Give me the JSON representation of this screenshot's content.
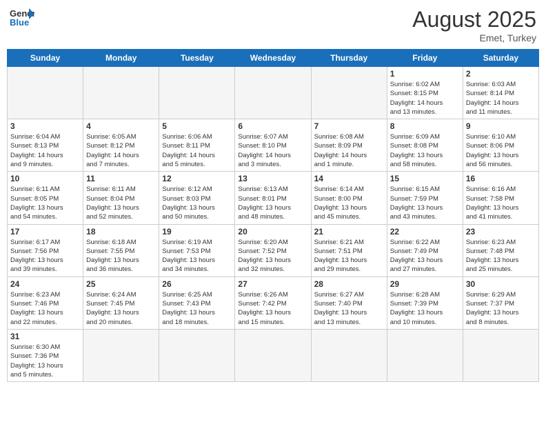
{
  "header": {
    "logo_text_general": "General",
    "logo_text_blue": "Blue",
    "month_year": "August 2025",
    "location": "Emet, Turkey"
  },
  "days_of_week": [
    "Sunday",
    "Monday",
    "Tuesday",
    "Wednesday",
    "Thursday",
    "Friday",
    "Saturday"
  ],
  "weeks": [
    [
      {
        "day": "",
        "info": ""
      },
      {
        "day": "",
        "info": ""
      },
      {
        "day": "",
        "info": ""
      },
      {
        "day": "",
        "info": ""
      },
      {
        "day": "",
        "info": ""
      },
      {
        "day": "1",
        "info": "Sunrise: 6:02 AM\nSunset: 8:15 PM\nDaylight: 14 hours\nand 13 minutes."
      },
      {
        "day": "2",
        "info": "Sunrise: 6:03 AM\nSunset: 8:14 PM\nDaylight: 14 hours\nand 11 minutes."
      }
    ],
    [
      {
        "day": "3",
        "info": "Sunrise: 6:04 AM\nSunset: 8:13 PM\nDaylight: 14 hours\nand 9 minutes."
      },
      {
        "day": "4",
        "info": "Sunrise: 6:05 AM\nSunset: 8:12 PM\nDaylight: 14 hours\nand 7 minutes."
      },
      {
        "day": "5",
        "info": "Sunrise: 6:06 AM\nSunset: 8:11 PM\nDaylight: 14 hours\nand 5 minutes."
      },
      {
        "day": "6",
        "info": "Sunrise: 6:07 AM\nSunset: 8:10 PM\nDaylight: 14 hours\nand 3 minutes."
      },
      {
        "day": "7",
        "info": "Sunrise: 6:08 AM\nSunset: 8:09 PM\nDaylight: 14 hours\nand 1 minute."
      },
      {
        "day": "8",
        "info": "Sunrise: 6:09 AM\nSunset: 8:08 PM\nDaylight: 13 hours\nand 58 minutes."
      },
      {
        "day": "9",
        "info": "Sunrise: 6:10 AM\nSunset: 8:06 PM\nDaylight: 13 hours\nand 56 minutes."
      }
    ],
    [
      {
        "day": "10",
        "info": "Sunrise: 6:11 AM\nSunset: 8:05 PM\nDaylight: 13 hours\nand 54 minutes."
      },
      {
        "day": "11",
        "info": "Sunrise: 6:11 AM\nSunset: 8:04 PM\nDaylight: 13 hours\nand 52 minutes."
      },
      {
        "day": "12",
        "info": "Sunrise: 6:12 AM\nSunset: 8:03 PM\nDaylight: 13 hours\nand 50 minutes."
      },
      {
        "day": "13",
        "info": "Sunrise: 6:13 AM\nSunset: 8:01 PM\nDaylight: 13 hours\nand 48 minutes."
      },
      {
        "day": "14",
        "info": "Sunrise: 6:14 AM\nSunset: 8:00 PM\nDaylight: 13 hours\nand 45 minutes."
      },
      {
        "day": "15",
        "info": "Sunrise: 6:15 AM\nSunset: 7:59 PM\nDaylight: 13 hours\nand 43 minutes."
      },
      {
        "day": "16",
        "info": "Sunrise: 6:16 AM\nSunset: 7:58 PM\nDaylight: 13 hours\nand 41 minutes."
      }
    ],
    [
      {
        "day": "17",
        "info": "Sunrise: 6:17 AM\nSunset: 7:56 PM\nDaylight: 13 hours\nand 39 minutes."
      },
      {
        "day": "18",
        "info": "Sunrise: 6:18 AM\nSunset: 7:55 PM\nDaylight: 13 hours\nand 36 minutes."
      },
      {
        "day": "19",
        "info": "Sunrise: 6:19 AM\nSunset: 7:53 PM\nDaylight: 13 hours\nand 34 minutes."
      },
      {
        "day": "20",
        "info": "Sunrise: 6:20 AM\nSunset: 7:52 PM\nDaylight: 13 hours\nand 32 minutes."
      },
      {
        "day": "21",
        "info": "Sunrise: 6:21 AM\nSunset: 7:51 PM\nDaylight: 13 hours\nand 29 minutes."
      },
      {
        "day": "22",
        "info": "Sunrise: 6:22 AM\nSunset: 7:49 PM\nDaylight: 13 hours\nand 27 minutes."
      },
      {
        "day": "23",
        "info": "Sunrise: 6:23 AM\nSunset: 7:48 PM\nDaylight: 13 hours\nand 25 minutes."
      }
    ],
    [
      {
        "day": "24",
        "info": "Sunrise: 6:23 AM\nSunset: 7:46 PM\nDaylight: 13 hours\nand 22 minutes."
      },
      {
        "day": "25",
        "info": "Sunrise: 6:24 AM\nSunset: 7:45 PM\nDaylight: 13 hours\nand 20 minutes."
      },
      {
        "day": "26",
        "info": "Sunrise: 6:25 AM\nSunset: 7:43 PM\nDaylight: 13 hours\nand 18 minutes."
      },
      {
        "day": "27",
        "info": "Sunrise: 6:26 AM\nSunset: 7:42 PM\nDaylight: 13 hours\nand 15 minutes."
      },
      {
        "day": "28",
        "info": "Sunrise: 6:27 AM\nSunset: 7:40 PM\nDaylight: 13 hours\nand 13 minutes."
      },
      {
        "day": "29",
        "info": "Sunrise: 6:28 AM\nSunset: 7:39 PM\nDaylight: 13 hours\nand 10 minutes."
      },
      {
        "day": "30",
        "info": "Sunrise: 6:29 AM\nSunset: 7:37 PM\nDaylight: 13 hours\nand 8 minutes."
      }
    ],
    [
      {
        "day": "31",
        "info": "Sunrise: 6:30 AM\nSunset: 7:36 PM\nDaylight: 13 hours\nand 5 minutes."
      },
      {
        "day": "",
        "info": ""
      },
      {
        "day": "",
        "info": ""
      },
      {
        "day": "",
        "info": ""
      },
      {
        "day": "",
        "info": ""
      },
      {
        "day": "",
        "info": ""
      },
      {
        "day": "",
        "info": ""
      }
    ]
  ]
}
